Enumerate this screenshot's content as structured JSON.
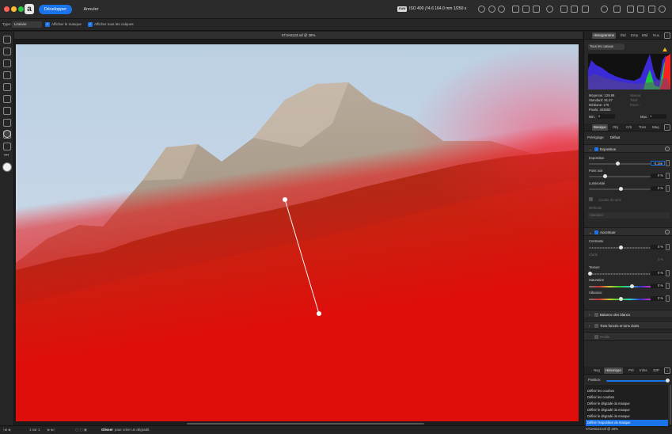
{
  "titlebar": {
    "develop_button": "Développer",
    "cancel_button": "Annuler",
    "raw_badge": "RAW",
    "camera_info": "ISO 400 ƒ/4.6 164.0 mm 1/250 s",
    "colors": {
      "accent": "#1a73e8",
      "close": "#ff5f57",
      "minimize": "#febc2e",
      "zoom": "#28c840"
    }
  },
  "context_toolbar": {
    "type_label": "Type:",
    "type_value": "Linéaire",
    "show_mask_label": "Afficher le masque",
    "show_all_layers_label": "Afficher tous les calques"
  },
  "document": {
    "title": "XT3A6123.raf @ 28%"
  },
  "status_bar": {
    "page_info": "1 sur 1",
    "hint_bold": "Glisser",
    "hint_rest": "pour créer un dégradé."
  },
  "histogram_panel": {
    "tabs": [
      "Histogramme",
      "Étd",
      "Emp",
      "Mtd",
      "M.a."
    ],
    "channel_select": "Tous les canaux",
    "stats": {
      "mean": "Moyenne: 129.99",
      "std": "Standard: 91.07",
      "median": "Médiane: 175",
      "pixels": "Pixels: 403800",
      "level": "Niveau:",
      "count": "Total:",
      "percent": "Pourc.:"
    },
    "min_label": "Min.",
    "min_value": "0",
    "max_label": "Max.",
    "max_value": "1"
  },
  "adjust_panel": {
    "tabs": [
      "Basique",
      "Obj",
      "Crb",
      "Tons",
      "Maq"
    ],
    "preset_label": "Préréglage:",
    "preset_value": "Défaut",
    "exposure_section": {
      "title": "Exposition",
      "exposure_label": "Exposition",
      "exposure_value": "-0,166",
      "black_point_label": "Point noir",
      "black_point_value": "0 %",
      "brightness_label": "Luminosité",
      "brightness_value": "0 %",
      "highlight_label": "Courbe de tons",
      "method_label": "Méthode",
      "method_value": "Standard"
    },
    "enhance_section": {
      "title": "Accentuer",
      "contrast_label": "Contraste",
      "contrast_value": "0 %",
      "clarity_label": "Clarté",
      "clarity_value": "0 %",
      "texture_label": "Texture",
      "texture_value": "0 %",
      "saturation_label": "Saturation",
      "saturation_value": "0 %",
      "vibrance_label": "Vibrance",
      "vibrance_value": "0 %"
    },
    "white_balance_title": "Balance des blancs",
    "shadows_title": "Tons foncés et tons clairs",
    "profile_title": "Profils"
  },
  "history_panel": {
    "tabs": [
      "Nvg",
      "Historique",
      "Pré",
      "Infos",
      "32P"
    ],
    "position_label": "Position:",
    "items": [
      "Définir les courbes",
      "Définir les courbes",
      "Définir le dégradé du masque",
      "Définir le dégradé du masque",
      "Définir le dégradé du masque",
      "Définir l'exposition du masque"
    ],
    "selected_index": 5
  },
  "navigator_footer": "XT3A6123.raf @ 28%",
  "icons": {
    "left_tools": [
      "hand-icon",
      "zoom-icon",
      "redeye-icon",
      "blemish-icon",
      "clone-icon",
      "patch-icon",
      "brush-icon",
      "erase-brush-icon",
      "paint-icon",
      "gradient-icon",
      "crop-icon",
      "more-icon",
      "color-swatch-icon"
    ]
  }
}
